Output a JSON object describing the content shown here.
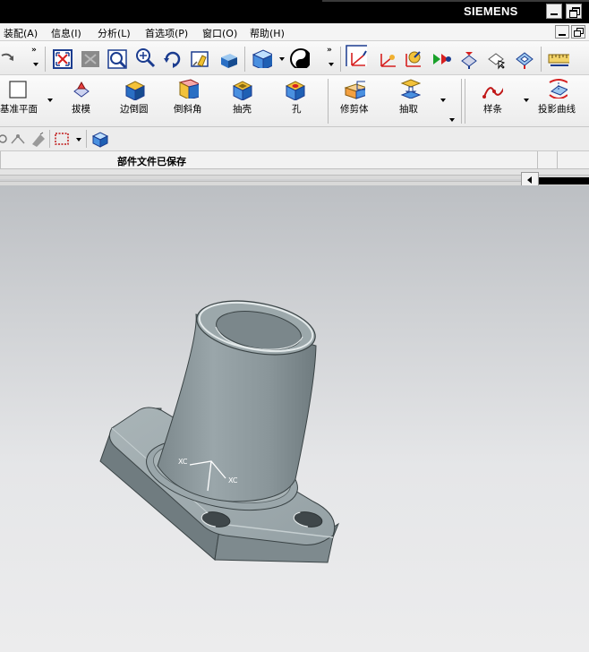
{
  "window": {
    "brand": "SIEMENS"
  },
  "menu": {
    "items": [
      {
        "label": "装配(A)"
      },
      {
        "label": "信息(I)"
      },
      {
        "label": "分析(L)"
      },
      {
        "label": "首选项(P)"
      },
      {
        "label": "窗口(O)"
      },
      {
        "label": "帮助(H)"
      }
    ]
  },
  "toolbar_main": {
    "icons": [
      "undo-icon",
      "fit-view-icon",
      "pan-icon",
      "zoom-window-icon",
      "zoom-icon",
      "rotate-icon",
      "edit-view-icon",
      "shaded-view-icon",
      "render-style-icon",
      "view-orient-icon"
    ],
    "overflow_label": "»"
  },
  "toolbar_features": {
    "items": [
      {
        "label": "基准平面",
        "icon": "datum-plane-icon"
      },
      {
        "label": "拔模",
        "icon": "draft-icon"
      },
      {
        "label": "边倒圆",
        "icon": "edge-blend-icon"
      },
      {
        "label": "倒斜角",
        "icon": "chamfer-icon"
      },
      {
        "label": "抽壳",
        "icon": "shell-icon"
      },
      {
        "label": "孔",
        "icon": "hole-icon"
      },
      {
        "label": "修剪体",
        "icon": "trim-body-icon"
      },
      {
        "label": "抽取",
        "icon": "extract-icon"
      },
      {
        "label": "样条",
        "icon": "spline-icon"
      },
      {
        "label": "投影曲线",
        "icon": "project-curve-icon"
      }
    ]
  },
  "status": {
    "message": "部件文件已保存"
  },
  "viewport": {
    "wcs_axis_labels": [
      "XC",
      "XC"
    ],
    "model": "flanged-bushing-part"
  },
  "colors": {
    "model_body": "#8f9ca0",
    "model_highlight": "#c6cfd1",
    "background_top": "#bcbfc3",
    "background_bottom": "#ececed",
    "accent_red": "#d62020"
  }
}
